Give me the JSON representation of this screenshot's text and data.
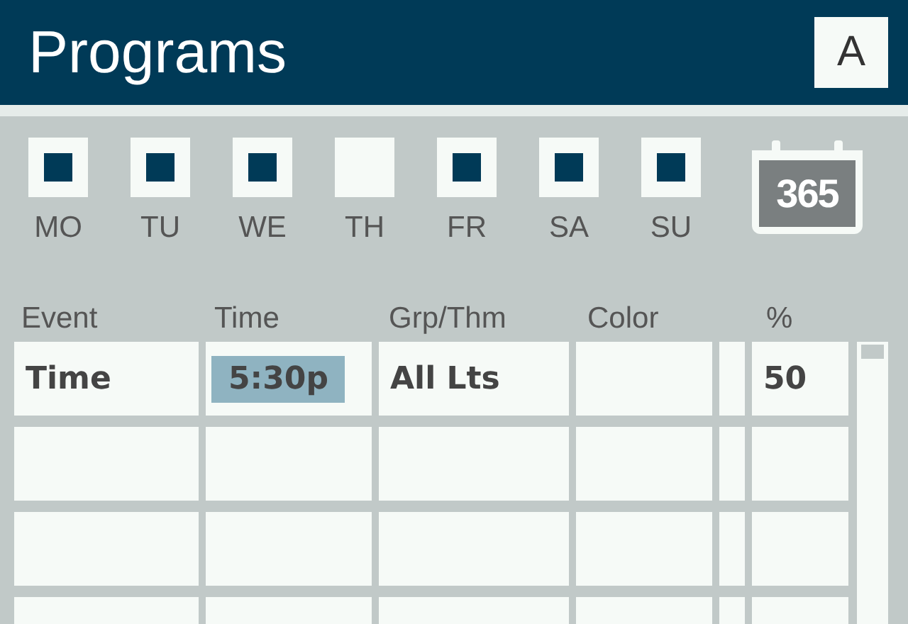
{
  "header": {
    "title": "Programs",
    "button": "A"
  },
  "days": [
    {
      "label": "MO",
      "checked": true
    },
    {
      "label": "TU",
      "checked": true
    },
    {
      "label": "WE",
      "checked": true
    },
    {
      "label": "TH",
      "checked": false
    },
    {
      "label": "FR",
      "checked": true
    },
    {
      "label": "SA",
      "checked": true
    },
    {
      "label": "SU",
      "checked": true
    }
  ],
  "calendar_button": "365",
  "table": {
    "columns": [
      "Event",
      "Time",
      "Grp/Thm",
      "Color",
      "%"
    ],
    "rows": [
      {
        "event": "Time",
        "time": "5:30p",
        "time_selected": true,
        "group": "All Lts",
        "percent": "50"
      }
    ]
  }
}
